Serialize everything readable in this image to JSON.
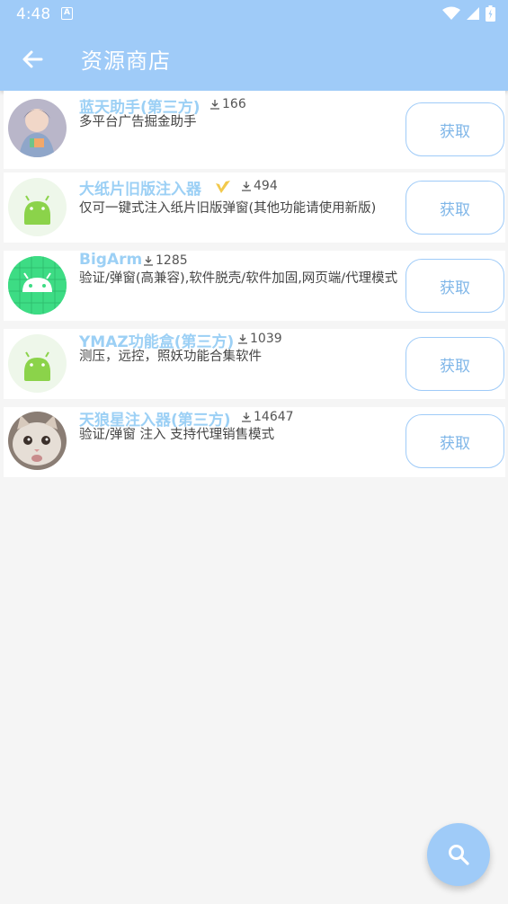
{
  "status_bar": {
    "time": "4:48",
    "a_badge": "A"
  },
  "app_bar": {
    "title": "资源商店"
  },
  "items": [
    {
      "name": "蓝天助手(第三方)",
      "downloads": "166",
      "description": "多平台广告掘金助手",
      "button": "获取",
      "avatar": "photo-boy-avatar"
    },
    {
      "name": "大纸片旧版注入器",
      "downloads": "494",
      "description": "仅可一键式注入纸片旧版弹窗(其他功能请使用新版)",
      "button": "获取",
      "avatar": "android-icon",
      "badge": "verified-badge-icon"
    },
    {
      "name": "BigArm",
      "downloads": "1285",
      "description": "验证/弹窗(高兼容),软件脱壳/软件加固,网页端/代理模式",
      "button": "获取",
      "avatar": "android-grid-icon"
    },
    {
      "name": "YMAZ功能盒(第三方)",
      "downloads": "1039",
      "description": "测压，远控，照妖功能合集软件",
      "button": "获取",
      "avatar": "android-icon"
    },
    {
      "name": "天狼星注入器(第三方)",
      "downloads": "14647",
      "description": "验证/弹窗 注入 支持代理销售模式",
      "button": "获取",
      "avatar": "photo-cat-avatar"
    }
  ],
  "colors": {
    "accent": "#9fcbf8",
    "name_text": "#9cd0f5",
    "android_green": "#8bd34a"
  }
}
